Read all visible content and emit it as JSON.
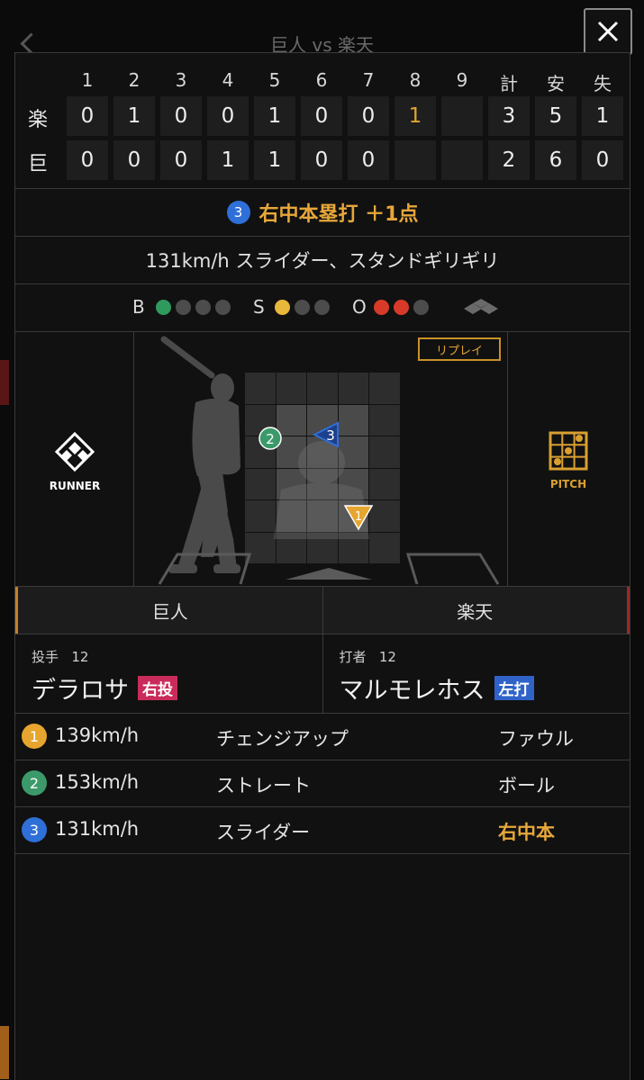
{
  "screen_title": "巨人 vs 楽天",
  "scoreboard": {
    "headers": [
      "1",
      "2",
      "3",
      "4",
      "5",
      "6",
      "7",
      "8",
      "9",
      "計",
      "安",
      "失"
    ],
    "rows": [
      {
        "team": "楽",
        "cells": [
          "0",
          "1",
          "0",
          "0",
          "1",
          "0",
          "0",
          "1",
          "",
          "3",
          "5",
          "1"
        ]
      },
      {
        "team": "巨",
        "cells": [
          "0",
          "0",
          "0",
          "1",
          "1",
          "0",
          "0",
          "",
          "",
          "2",
          "6",
          "0"
        ]
      }
    ]
  },
  "play": {
    "number": "3",
    "result": "右中本塁打 ＋1点",
    "description": "131km/h スライダー、スタンドギリギリ"
  },
  "count": {
    "ball_label": "B",
    "strike_label": "S",
    "out_label": "O",
    "balls": 1,
    "strikes": 1,
    "outs": 2
  },
  "field": {
    "runner_label": "RUNNER",
    "pitch_label": "PITCH",
    "replay_label": "リプレイ",
    "pitch_markers": [
      {
        "number": "1",
        "color": "#e6a52e"
      },
      {
        "number": "2",
        "color": "#3c9a6a"
      },
      {
        "number": "3",
        "color": "#2f6fd8"
      }
    ]
  },
  "teams": {
    "left": "巨人",
    "right": "楽天"
  },
  "pitcher": {
    "role": "投手",
    "number": "12",
    "name": "デラロサ",
    "hand": "右投",
    "hand_color": "#c92c5a"
  },
  "batter": {
    "role": "打者",
    "number": "12",
    "name": "マルモレホス",
    "hand": "左打",
    "hand_color": "#2f63c8"
  },
  "pitches": [
    {
      "num": "1",
      "speed": "139km/h",
      "type": "チェンジアップ",
      "result": "ファウル",
      "color": "#e6a52e",
      "highlight": false
    },
    {
      "num": "2",
      "speed": "153km/h",
      "type": "ストレート",
      "result": "ボール",
      "color": "#3c9a6a",
      "highlight": false
    },
    {
      "num": "3",
      "speed": "131km/h",
      "type": "スライダー",
      "result": "右中本",
      "color": "#2f6fd8",
      "highlight": true
    }
  ],
  "colors": {
    "accent": "#e7a73a",
    "ball": "#2f9a5e",
    "strike": "#e8b83a",
    "out": "#d83a2a"
  }
}
